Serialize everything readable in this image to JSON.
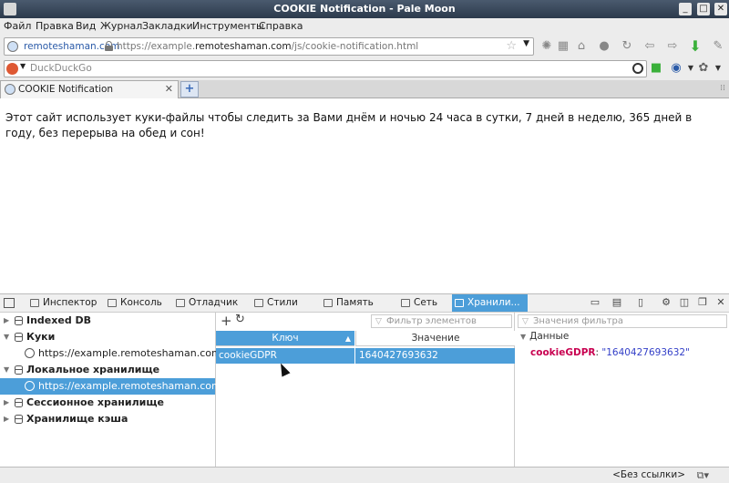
{
  "window": {
    "title": "COOKIE Notification - Pale Moon",
    "controls": [
      "_",
      "□",
      "✕"
    ]
  },
  "menu": [
    "Файл",
    "Правка",
    "Вид",
    "Журнал",
    "Закладки",
    "Инструменты",
    "Справка"
  ],
  "navbar": {
    "site_identity": "remoteshaman.com",
    "url_prefix": "https://example.",
    "url_host": "remoteshaman.com",
    "url_path": "/js/cookie-notification.html"
  },
  "search": {
    "placeholder": "DuckDuckGo"
  },
  "tab": {
    "label": "COOKIE Notification",
    "close": "✕",
    "new_tab": "+"
  },
  "page": {
    "text": "Этот сайт использует куки-файлы чтобы следить за Вами днём и ночью 24 часа в сутки, 7 дней в неделю, 365 дней в году, без перерыва на обед и сон!"
  },
  "devtools": {
    "tabs": [
      "Инспектор",
      "Консоль",
      "Отладчик",
      "Стили",
      "Память",
      "Сеть",
      "Хранили..."
    ],
    "active_tab": "Хранили...",
    "tree": [
      {
        "label": "Indexed DB",
        "kind": "group",
        "expanded": false
      },
      {
        "label": "Куки",
        "kind": "group",
        "expanded": true
      },
      {
        "label": "https://example.remoteshaman.com",
        "kind": "origin"
      },
      {
        "label": "Локальное хранилище",
        "kind": "group",
        "expanded": true
      },
      {
        "label": "https://example.remoteshaman.com",
        "kind": "origin",
        "selected": true
      },
      {
        "label": "Сессионное хранилище",
        "kind": "group",
        "expanded": false
      },
      {
        "label": "Хранилище кэша",
        "kind": "group",
        "expanded": false
      }
    ],
    "table": {
      "filter_placeholder": "Фильтр элементов",
      "columns": [
        "Ключ",
        "Значение"
      ],
      "rows": [
        {
          "key": "cookieGDPR",
          "value": "1640427693632"
        }
      ]
    },
    "sidebar": {
      "filter_placeholder": "Значения фильтра",
      "section_title": "Данные",
      "entry_key": "cookieGDPR",
      "entry_sep": ": ",
      "entry_value": "\"1640427693632\""
    }
  },
  "statusbar": {
    "text": "<Без ссылки>"
  },
  "colors": {
    "accent": "#4c9ed9",
    "key_color": "#c80050",
    "value_color": "#3440c8"
  }
}
